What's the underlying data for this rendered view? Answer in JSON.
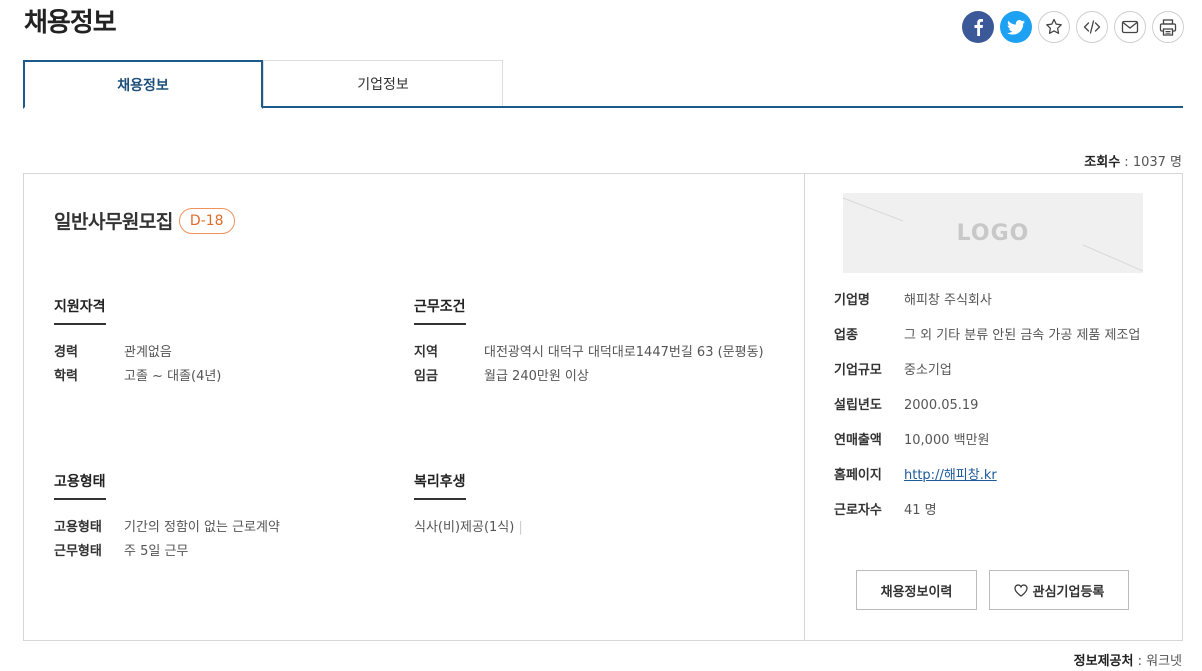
{
  "page_title": "채용정보",
  "share": {
    "facebook": "facebook-icon",
    "twitter": "twitter-icon",
    "bookmark": "star-icon",
    "embed": "code-icon",
    "email": "mail-icon",
    "print": "print-icon"
  },
  "tabs": [
    {
      "label": "채용정보",
      "active": true
    },
    {
      "label": "기업정보",
      "active": false
    }
  ],
  "views": {
    "label": "조회수",
    "value": " : 1037 명"
  },
  "job": {
    "title": "일반사무원모집",
    "dday": "D-18"
  },
  "qualification": {
    "title": "지원자격",
    "rows": [
      {
        "k": "경력",
        "v": "관계없음"
      },
      {
        "k": "학력",
        "v": "고졸 ~ 대졸(4년)"
      }
    ]
  },
  "conditions": {
    "title": "근무조건",
    "rows": [
      {
        "k": "지역",
        "v": "대전광역시 대덕구 대덕대로1447번길 63 (문평동)"
      },
      {
        "k": "임금",
        "v": "월급 240만원 이상"
      }
    ]
  },
  "employment": {
    "title": "고용형태",
    "rows": [
      {
        "k": "고용형태",
        "v": "기간의 정함이 없는 근로계약"
      },
      {
        "k": "근무형태",
        "v": "주 5일 근무"
      }
    ]
  },
  "welfare": {
    "title": "복리후생",
    "items": "식사(비)제공(1식)"
  },
  "company": {
    "logo_text": "LOGO",
    "rows": [
      {
        "k": "기업명",
        "v": "해피창 주식회사"
      },
      {
        "k": "업종",
        "v": "그 외 기타 분류 안된 금속 가공 제품 제조업"
      },
      {
        "k": "기업규모",
        "v": "중소기업"
      },
      {
        "k": "설립년도",
        "v": "2000.05.19"
      },
      {
        "k": "연매출액",
        "v": "10,000 백만원"
      },
      {
        "k": "홈페이지",
        "v": "http://해피창.kr"
      },
      {
        "k": "근로자수",
        "v": "41 명"
      }
    ]
  },
  "buttons": {
    "history": "채용정보이력",
    "interest": "관심기업등록"
  },
  "provider": {
    "label": "정보제공처",
    "value": " : 워크넷"
  },
  "colors": {
    "primary": "#1d5a8a",
    "dday": "#e06b2a",
    "facebook": "#3b5998",
    "twitter": "#1da1f2"
  }
}
